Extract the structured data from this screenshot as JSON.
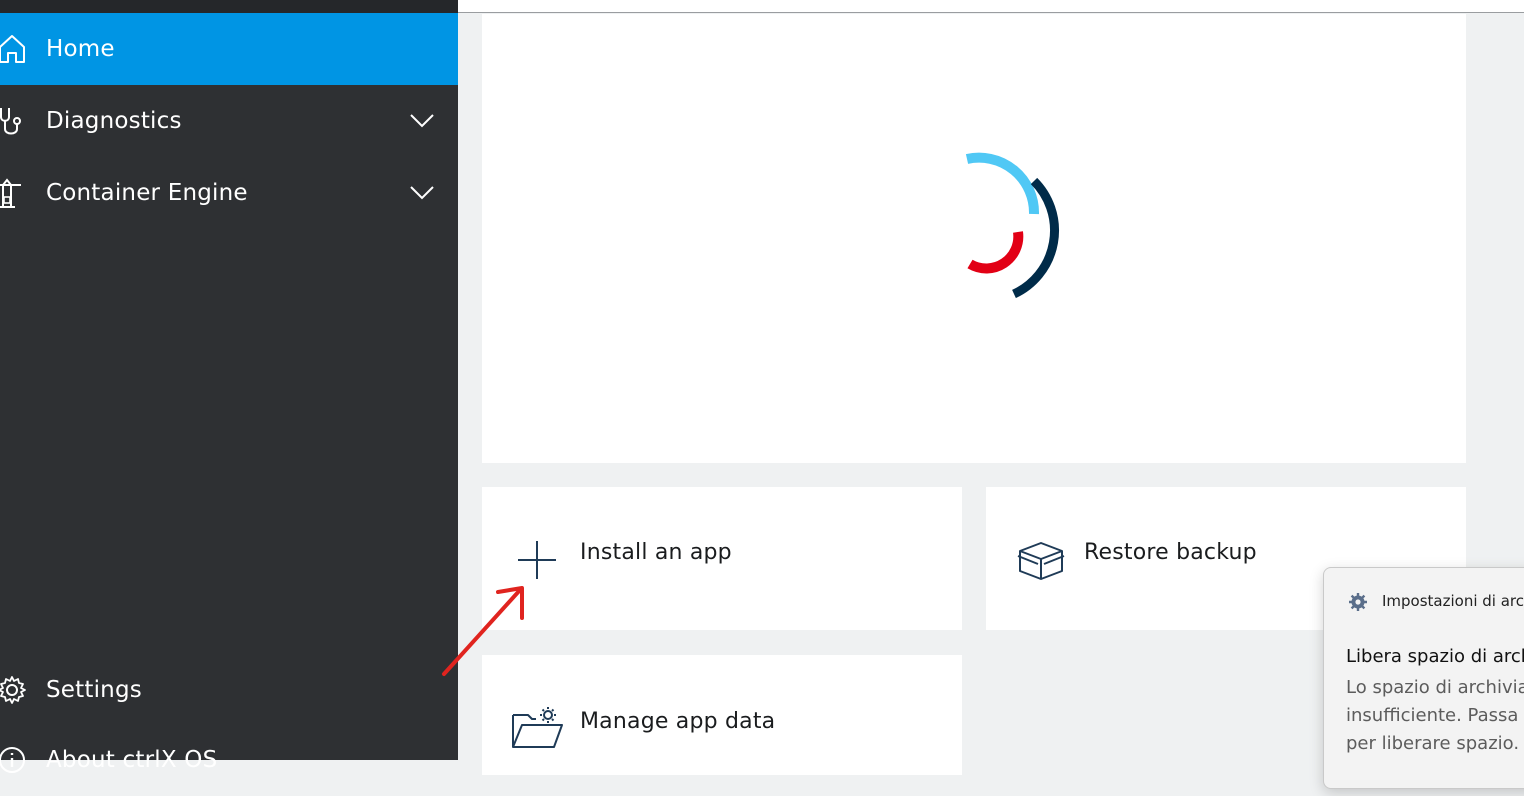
{
  "sidebar": {
    "items": [
      {
        "label": "Home",
        "icon": "home-icon",
        "active": true
      },
      {
        "label": "Diagnostics",
        "icon": "stethoscope-icon",
        "expandable": true
      },
      {
        "label": "Container Engine",
        "icon": "crane-icon",
        "expandable": true
      }
    ],
    "bottom_items": [
      {
        "label": "Settings",
        "icon": "gear-icon"
      },
      {
        "label": "About ctrlX OS",
        "icon": "info-icon"
      }
    ]
  },
  "tiles": {
    "install": {
      "label": "Install an app",
      "icon": "plus-icon"
    },
    "restore": {
      "label": "Restore backup",
      "icon": "box-icon"
    },
    "manage": {
      "label": "Manage app data",
      "icon": "folder-gear-icon"
    }
  },
  "notification": {
    "app": "Impostazioni di archiviazione",
    "title": "Libera spazio di archiviazione",
    "body": "Lo spazio di archiviazione è\ninsufficiente. Passa a Impostazioni\nper liberare spazio."
  },
  "colors": {
    "accent": "#0095e4",
    "sidebar_bg": "#2e3033",
    "spinner_light_blue": "#50c8f5",
    "spinner_red": "#e20015",
    "spinner_dark_blue": "#002b49",
    "annotation_arrow": "#e0241f"
  }
}
